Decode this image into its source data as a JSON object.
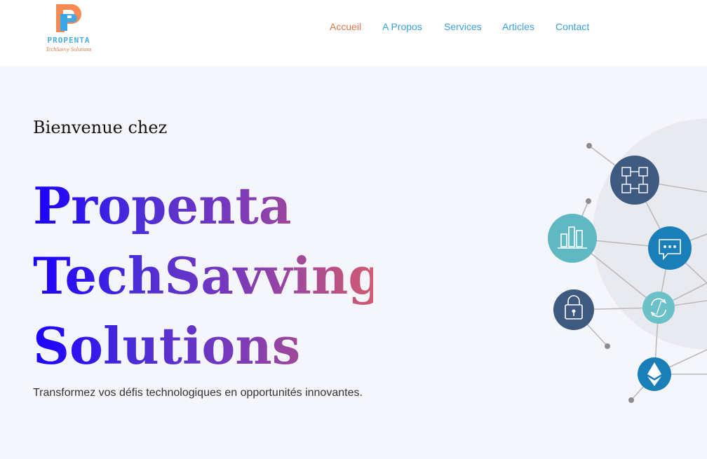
{
  "brand": {
    "name": "PROPENTA",
    "tagline": "TechSavvy Solutions",
    "colors": {
      "orange": "#f58a52",
      "blue": "#3aa6e6",
      "name": "#4aaee0",
      "tagline": "#e07a4a"
    }
  },
  "nav": {
    "items": [
      {
        "label": "Accueil",
        "active": true
      },
      {
        "label": "A Propos",
        "active": false
      },
      {
        "label": "Services",
        "active": false
      },
      {
        "label": "Articles",
        "active": false
      },
      {
        "label": "Contact",
        "active": false
      }
    ],
    "active_color": "#d9774b",
    "link_color": "#3aa0dd"
  },
  "hero": {
    "welcome": "Bienvenue chez",
    "headline": [
      "Propenta",
      "TechSavving",
      "Solutions"
    ],
    "subtitle": "Transformez vos défis technologiques en opportunités innovantes.",
    "gradient": [
      "#1a00ff",
      "#d25a72"
    ]
  },
  "illustration": {
    "nodes": [
      {
        "icon": "blockchain-cubes-icon",
        "color": "#3e5a80"
      },
      {
        "icon": "bar-chart-icon",
        "color": "#5fb8c2"
      },
      {
        "icon": "chat-bubble-icon",
        "color": "#1a7fb8"
      },
      {
        "icon": "padlock-icon",
        "color": "#3e5a80"
      },
      {
        "icon": "refresh-cycle-icon",
        "color": "#6cc1c9"
      },
      {
        "icon": "ethereum-icon",
        "color": "#1a7fb8"
      }
    ]
  }
}
